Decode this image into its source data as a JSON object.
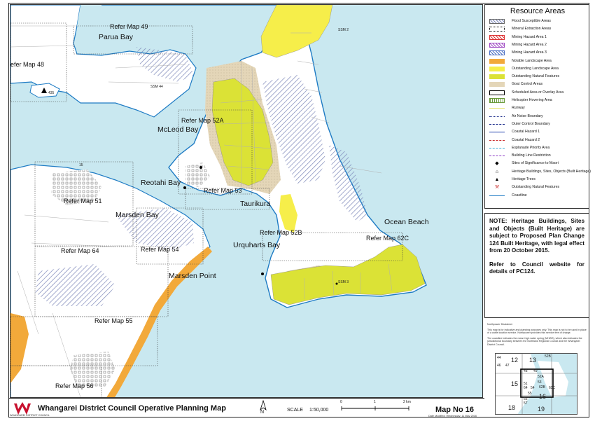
{
  "map": {
    "place_labels": [
      {
        "id": "parua-bay",
        "text": "Parua Bay"
      },
      {
        "id": "mcleod-bay",
        "text": "McLeod Bay"
      },
      {
        "id": "reotahi-bay",
        "text": "Reotahi Bay"
      },
      {
        "id": "taurikura",
        "text": "Taurikura"
      },
      {
        "id": "marsden-bay",
        "text": "Marsden Bay"
      },
      {
        "id": "urquharts-bay",
        "text": "Urquharts Bay"
      },
      {
        "id": "ocean-beach",
        "text": "Ocean Beach"
      },
      {
        "id": "marsden-point",
        "text": "Marsden Point"
      }
    ],
    "refer_labels": [
      {
        "id": "refer-49",
        "text": "Refer Map 49"
      },
      {
        "id": "refer-48",
        "text": "efer Map 48"
      },
      {
        "id": "refer-52a",
        "text": "Refer Map 52A"
      },
      {
        "id": "refer-53",
        "text": "Refer Map 53"
      },
      {
        "id": "refer-51",
        "text": "Refer Map 51"
      },
      {
        "id": "refer-52b",
        "text": "Refer Map 52B"
      },
      {
        "id": "refer-62c",
        "text": "Refer Map 62C"
      },
      {
        "id": "refer-64",
        "text": "Refer Map 64"
      },
      {
        "id": "refer-54",
        "text": "Refer Map 54"
      },
      {
        "id": "refer-55",
        "text": "Refer Map 55"
      },
      {
        "id": "refer-56",
        "text": "Refer Map 56"
      }
    ],
    "small_labels": [
      {
        "id": "ssm2",
        "text": "SSM 2"
      },
      {
        "id": "ssm44",
        "text": "SSM 44"
      },
      {
        "id": "ssm3",
        "text": "SSM 3"
      },
      {
        "id": "tree-435",
        "text": "435"
      },
      {
        "id": "tree-15",
        "text": "15"
      }
    ]
  },
  "legend": {
    "title": "Resource Areas",
    "items": [
      {
        "label": "Flood Susceptible Areas",
        "swatch": "hatch-blue"
      },
      {
        "label": "Mineral Extraction Areas",
        "swatch": "border-black"
      },
      {
        "label": "Mining Hazard Area 1",
        "swatch": "cross-red"
      },
      {
        "label": "Mining Hazard Area 2",
        "swatch": "cross-purple"
      },
      {
        "label": "Mining Hazard Area 3",
        "swatch": "cross-blue"
      },
      {
        "label": "Notable Landscape Area",
        "swatch": "solid-orange"
      },
      {
        "label": "Outstanding Landscape Area",
        "swatch": "solid-yellow"
      },
      {
        "label": "Outstanding Natural Features",
        "swatch": "solid-yellowgreen"
      },
      {
        "label": "Goat Control Areas",
        "swatch": "dots-tan"
      },
      {
        "label": "Scheduled Area or Overlay Area",
        "swatch": "box-black"
      },
      {
        "label": "Helicopter Hovering Area",
        "swatch": "hatch-green"
      },
      {
        "label": "Runway",
        "swatch": "line-yellow"
      },
      {
        "label": "Air Noise Boundary",
        "swatch": "dotted-navy"
      },
      {
        "label": "Outer Control Boundary",
        "swatch": "dashed-navy"
      },
      {
        "label": "Coastal Hazard 1",
        "swatch": "line-blue"
      },
      {
        "label": "Coastal Hazard 2",
        "swatch": "dashed-red"
      },
      {
        "label": "Esplanade Priority Area",
        "swatch": "dashdot-cyan"
      },
      {
        "label": "Building Line Restriction",
        "swatch": "dashed-purple"
      },
      {
        "label": "Sites of Significance to Maori",
        "swatch": "pt-diamond"
      },
      {
        "label": "Heritage Buildings, Sites, Objects (Built Heritage)",
        "swatch": "pt-building"
      },
      {
        "label": "Heritage Trees",
        "swatch": "pt-tree"
      },
      {
        "label": "Outstanding Natural Features",
        "swatch": "pt-pick"
      },
      {
        "label": "Coastline",
        "swatch": "line-coast"
      }
    ]
  },
  "note": {
    "paragraph1": "NOTE: Heritage Buildings, Sites and Objects (Built Heritage) are subject to Proposed Plan Change 124 Built Heritage, with legal effect from 20 October 2015.",
    "paragraph2": "Refer to Council website for details of PC124."
  },
  "disclaimer": {
    "heading": "Northpower Disclaimer",
    "text1": "This map is for indicative and planning purposes only. This map is not to be used in place of a cable location service. Northpower provides this service free of charge.",
    "text2": "The coastline indicates the mean high water spring (MHWS), which also indicates the jurisdictional boundary between the Northland Regional Council and the Whangarei District Council."
  },
  "keymap": {
    "cells": [
      {
        "id": "k12",
        "text": "12"
      },
      {
        "id": "k13",
        "text": "13"
      },
      {
        "id": "k52b",
        "text": "52B"
      },
      {
        "id": "k44",
        "text": "44"
      },
      {
        "id": "k46",
        "text": "46"
      },
      {
        "id": "k47",
        "text": "47"
      },
      {
        "id": "k48",
        "text": "48"
      },
      {
        "id": "k49",
        "text": "49"
      },
      {
        "id": "k52a",
        "text": "52A"
      },
      {
        "id": "k15",
        "text": "15"
      },
      {
        "id": "k51",
        "text": "51"
      },
      {
        "id": "k53",
        "text": "53"
      },
      {
        "id": "k64",
        "text": "64"
      },
      {
        "id": "k54",
        "text": "54"
      },
      {
        "id": "k62b",
        "text": "62B"
      },
      {
        "id": "k62c",
        "text": "62C"
      },
      {
        "id": "k55",
        "text": "55"
      },
      {
        "id": "k16",
        "text": "16"
      },
      {
        "id": "k56",
        "text": "56"
      },
      {
        "id": "k57",
        "text": "57"
      },
      {
        "id": "k18",
        "text": "18"
      },
      {
        "id": "k19",
        "text": "19"
      }
    ]
  },
  "titlebar": {
    "logo_text": "WHANGAREI DISTRICT COUNCIL",
    "title": "Whangarei District Council Operative Planning Map",
    "north": "N",
    "scale_label": "SCALE",
    "scale_value": "1:50,000",
    "scalebar_ticks": [
      "0",
      "1",
      "2 km"
    ],
    "map_no": "Map No 16",
    "date_modified": "Date Modified: Wednesday, 11 May 2016"
  },
  "colors": {
    "sea": "#c9e8f0",
    "land": "#ffffff",
    "outstanding_natural": "#dbe236",
    "outstanding_landscape": "#f6ee4a",
    "notable_landscape": "#f2a93a",
    "goat": "#e4d6b8",
    "flood_hatch": "#7b86b8",
    "coastline": "#1e7bc4"
  }
}
